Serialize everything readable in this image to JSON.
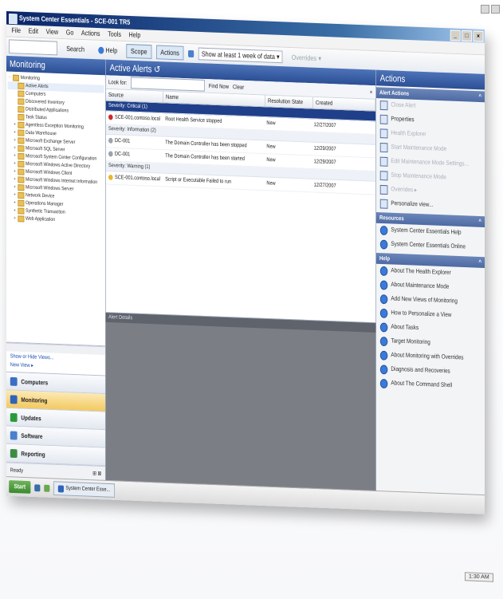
{
  "window": {
    "title": "System Center Essentials - SCE-001 TR5",
    "controls": [
      "_",
      "□",
      "×"
    ]
  },
  "menubar": [
    "File",
    "Edit",
    "View",
    "Go",
    "Actions",
    "Tools",
    "Help"
  ],
  "toolbar": {
    "search_placeholder": "",
    "search_label": "Search",
    "help_label": "Help",
    "scope_label": "Scope",
    "actions_toggle": "Actions",
    "alerts_filter": "Show at least 1 week of data",
    "overrides": "Overrides"
  },
  "nav": {
    "title": "Monitoring",
    "tree": [
      {
        "label": "Monitoring",
        "level": 0,
        "twisty": "-"
      },
      {
        "label": "Active Alerts",
        "level": 1,
        "twisty": "",
        "selected": true
      },
      {
        "label": "Computers",
        "level": 1,
        "twisty": ""
      },
      {
        "label": "Discovered Inventory",
        "level": 1,
        "twisty": ""
      },
      {
        "label": "Distributed Applications",
        "level": 1,
        "twisty": ""
      },
      {
        "label": "Task Status",
        "level": 1,
        "twisty": ""
      },
      {
        "label": "Agentless Exception Monitoring",
        "level": 1,
        "twisty": "+"
      },
      {
        "label": "Data Warehouse",
        "level": 1,
        "twisty": "+"
      },
      {
        "label": "Microsoft Exchange Server",
        "level": 1,
        "twisty": "+"
      },
      {
        "label": "Microsoft SQL Server",
        "level": 1,
        "twisty": "+"
      },
      {
        "label": "Microsoft System Center Configuration",
        "level": 1,
        "twisty": "+"
      },
      {
        "label": "Microsoft Windows Active Directory",
        "level": 1,
        "twisty": "+"
      },
      {
        "label": "Microsoft Windows Client",
        "level": 1,
        "twisty": "+"
      },
      {
        "label": "Microsoft Windows Internet Information",
        "level": 1,
        "twisty": "+"
      },
      {
        "label": "Microsoft Windows Server",
        "level": 1,
        "twisty": "+"
      },
      {
        "label": "Network Device",
        "level": 1,
        "twisty": "+"
      },
      {
        "label": "Operations Manager",
        "level": 1,
        "twisty": "+"
      },
      {
        "label": "Synthetic Transaction",
        "level": 1,
        "twisty": "+"
      },
      {
        "label": "Web Application",
        "level": 1,
        "twisty": "+"
      }
    ],
    "links": [
      "Show or Hide Views...",
      "New View ▸"
    ],
    "wunderbar": [
      {
        "label": "Computers",
        "color": "#3a6fc4"
      },
      {
        "label": "Monitoring",
        "color": "#2f64b8",
        "active": true
      },
      {
        "label": "Updates",
        "color": "#2a9a3c"
      },
      {
        "label": "Software",
        "color": "#4a80cc"
      },
      {
        "label": "Reporting",
        "color": "#3c8d42"
      }
    ],
    "footer_left": "Ready",
    "footer_right": "⊞ ⊠"
  },
  "alerts": {
    "title": "Active Alerts ↺",
    "look_for_label": "Look for:",
    "find_now": "Find Now",
    "clear": "Clear",
    "close_x": "×",
    "columns": [
      "Source",
      "Name",
      "Resolution State",
      "Created"
    ],
    "groups": [
      {
        "label": "Severity: Critical (1)",
        "selected": true,
        "rows": [
          {
            "source": "SCE-001.contoso.local",
            "name": "Root Health Service stopped",
            "state": "New",
            "created": "12/27/2007",
            "sev": "#cc2b2b"
          }
        ]
      },
      {
        "label": "Severity: Information (2)",
        "selected": false,
        "rows": [
          {
            "source": "DC-001",
            "name": "The Domain Controller has been stopped",
            "state": "New",
            "created": "12/29/2007",
            "sev": "#9aa3af"
          },
          {
            "source": "DC-001",
            "name": "The Domain Controller has been started",
            "state": "New",
            "created": "12/29/2007",
            "sev": "#9aa3af"
          }
        ]
      },
      {
        "label": "Severity: Warning (1)",
        "selected": false,
        "rows": [
          {
            "source": "SCE-001.contoso.local",
            "name": "Script or Executable Failed to run",
            "state": "New",
            "created": "12/27/2007",
            "sev": "#e8b72c"
          }
        ]
      }
    ],
    "detail_title": "Alert Details"
  },
  "actions": {
    "title": "Actions",
    "sections": [
      {
        "title": "Alert Actions",
        "collapse": "^",
        "items": [
          {
            "label": "Close Alert",
            "dim": true,
            "icon": "close-alert-icon"
          },
          {
            "label": "Properties",
            "dim": false,
            "icon": "properties-icon"
          },
          {
            "label": "Health Explorer",
            "dim": true,
            "icon": "health-explorer-icon"
          },
          {
            "label": "Start Maintenance Mode",
            "dim": true,
            "icon": "maintenance-icon"
          },
          {
            "label": "Edit Maintenance Mode Settings...",
            "dim": true,
            "icon": "maintenance-icon"
          },
          {
            "label": "Stop Maintenance Mode",
            "dim": true,
            "icon": "maintenance-icon"
          },
          {
            "label": "Overrides ▸",
            "dim": true,
            "icon": "overrides-icon"
          },
          {
            "label": "Personalize view...",
            "dim": false,
            "icon": "personalize-icon"
          }
        ]
      },
      {
        "title": "Resources",
        "collapse": "^",
        "items": [
          {
            "label": "System Center Essentials Help",
            "dim": false,
            "icon": "help-icon"
          },
          {
            "label": "System Center Essentials Online",
            "dim": false,
            "icon": "help-icon"
          }
        ]
      },
      {
        "title": "Help",
        "collapse": "^",
        "items": [
          {
            "label": "About The Health Explorer",
            "dim": false,
            "icon": "help-icon"
          },
          {
            "label": "About Maintenance Mode",
            "dim": false,
            "icon": "help-icon"
          },
          {
            "label": "Add New Views of Monitoring",
            "dim": false,
            "icon": "help-icon"
          },
          {
            "label": "How to Personalize a View",
            "dim": false,
            "icon": "help-icon"
          },
          {
            "label": "About Tasks",
            "dim": false,
            "icon": "help-icon"
          },
          {
            "label": "Target Monitoring",
            "dim": false,
            "icon": "help-icon"
          },
          {
            "label": "About Monitoring with Overrides",
            "dim": false,
            "icon": "help-icon"
          },
          {
            "label": "Diagnosis and Recoveries",
            "dim": false,
            "icon": "help-icon"
          },
          {
            "label": "About The Command Shell",
            "dim": false,
            "icon": "help-icon"
          }
        ]
      }
    ]
  },
  "taskbar": {
    "start": "Start",
    "task": "System Center Esse...",
    "clock": "1:30 AM"
  }
}
